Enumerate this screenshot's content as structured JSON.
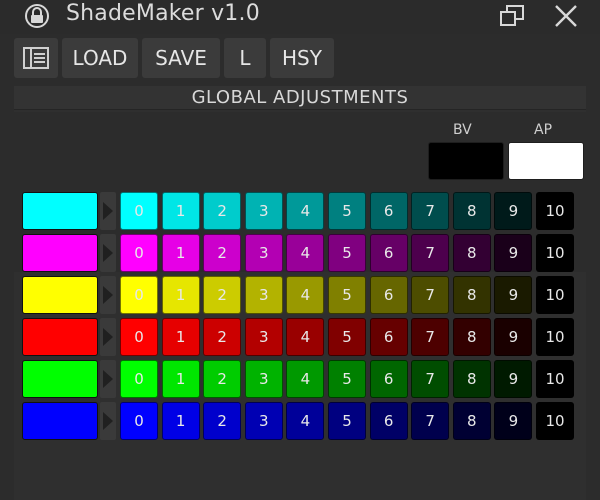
{
  "window": {
    "title": "ShadeMaker v1.0",
    "icons": {
      "app": "padlock-icon",
      "restore": "restore-window-icon",
      "close": "close-icon"
    }
  },
  "toolbar": {
    "menu_icon": "panel-list-icon",
    "load_label": "LOAD",
    "save_label": "SAVE",
    "l_label": "L",
    "hsy_label": "HSY"
  },
  "panel": {
    "header": "GLOBAL ADJUSTMENTS",
    "bv_label": "BV",
    "ap_label": "AP",
    "bv_color": "#000000",
    "ap_color": "#ffffff"
  },
  "shade_numbers": [
    "0",
    "1",
    "2",
    "3",
    "4",
    "5",
    "6",
    "7",
    "8",
    "9",
    "10"
  ],
  "rows": [
    {
      "name": "cyan",
      "base": "#00ffff",
      "shades": [
        "#00ffff",
        "#00e6e6",
        "#00cccc",
        "#00b3b3",
        "#009999",
        "#008080",
        "#006666",
        "#004d4d",
        "#003333",
        "#001a1a",
        "#000000"
      ]
    },
    {
      "name": "magenta",
      "base": "#ff00ff",
      "shades": [
        "#ff00ff",
        "#e600e6",
        "#cc00cc",
        "#b300b3",
        "#990099",
        "#800080",
        "#660066",
        "#4d004d",
        "#330033",
        "#1a001a",
        "#000000"
      ]
    },
    {
      "name": "yellow",
      "base": "#ffff00",
      "shades": [
        "#ffff00",
        "#e6e600",
        "#cccc00",
        "#b3b300",
        "#999900",
        "#808000",
        "#666600",
        "#4d4d00",
        "#333300",
        "#1a1a00",
        "#000000"
      ]
    },
    {
      "name": "red",
      "base": "#ff0000",
      "shades": [
        "#ff0000",
        "#e60000",
        "#cc0000",
        "#b30000",
        "#990000",
        "#800000",
        "#660000",
        "#4d0000",
        "#330000",
        "#1a0000",
        "#000000"
      ]
    },
    {
      "name": "green",
      "base": "#00ff00",
      "shades": [
        "#00ff00",
        "#00e600",
        "#00cc00",
        "#00b300",
        "#009900",
        "#008000",
        "#006600",
        "#004d00",
        "#003300",
        "#001a00",
        "#000000"
      ]
    },
    {
      "name": "blue",
      "base": "#0000ff",
      "shades": [
        "#0000ff",
        "#0000e6",
        "#0000cc",
        "#0000b3",
        "#000099",
        "#000080",
        "#000066",
        "#00004d",
        "#000033",
        "#00001a",
        "#000000"
      ]
    }
  ]
}
